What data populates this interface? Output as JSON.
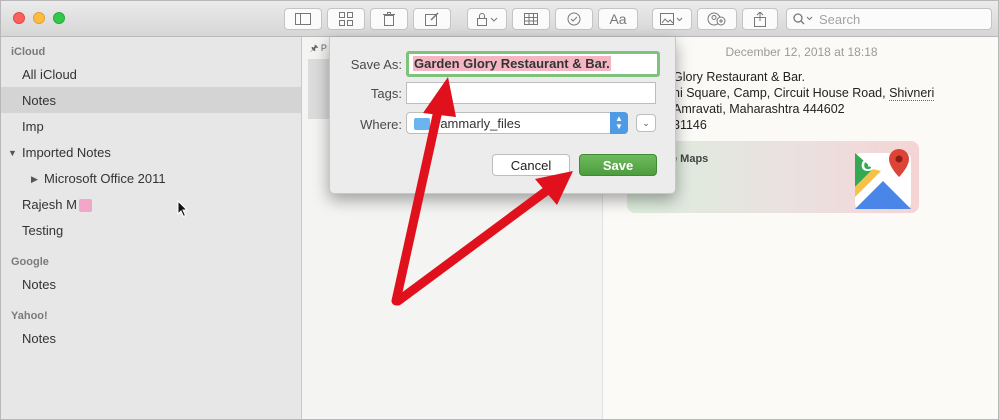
{
  "toolbar": {
    "search_placeholder": "Search",
    "font_button_label": "Aa"
  },
  "sidebar": {
    "accounts": [
      {
        "name": "iCloud"
      },
      {
        "name": "Google"
      },
      {
        "name": "Yahoo!"
      }
    ],
    "icloud_items": [
      "All iCloud",
      "Notes",
      "Imp",
      "Imported Notes",
      "Microsoft Office 2011",
      "Rajesh M",
      "Testing"
    ],
    "google_items": [
      "Notes"
    ],
    "yahoo_items": [
      "Notes"
    ],
    "selected_item": "Notes"
  },
  "note_list": {
    "pinned_label": "P"
  },
  "editor": {
    "date": "December 12, 2018 at 18:18",
    "line1": "Glory Restaurant & Bar.",
    "line2_prefix": "ni Square, Camp, Circuit House Road, ",
    "line2_misspelled": "Shivneri",
    "line3": "Amravati, Maharashtra 444602",
    "line4": "31146",
    "maps_card_title": "e Maps"
  },
  "dialog": {
    "save_as_label": "Save As:",
    "save_as_value": "Garden Glory Restaurant & Bar.",
    "tags_label": "Tags:",
    "tags_value": "",
    "where_label": "Where:",
    "where_value": "rammarly_files",
    "cancel_label": "Cancel",
    "save_label": "Save"
  },
  "colors": {
    "save_button": "#4d9c3e",
    "focus_ring": "#7fc27b",
    "arrow": "#e0101c",
    "selection_highlight": "#f4b6c2"
  }
}
